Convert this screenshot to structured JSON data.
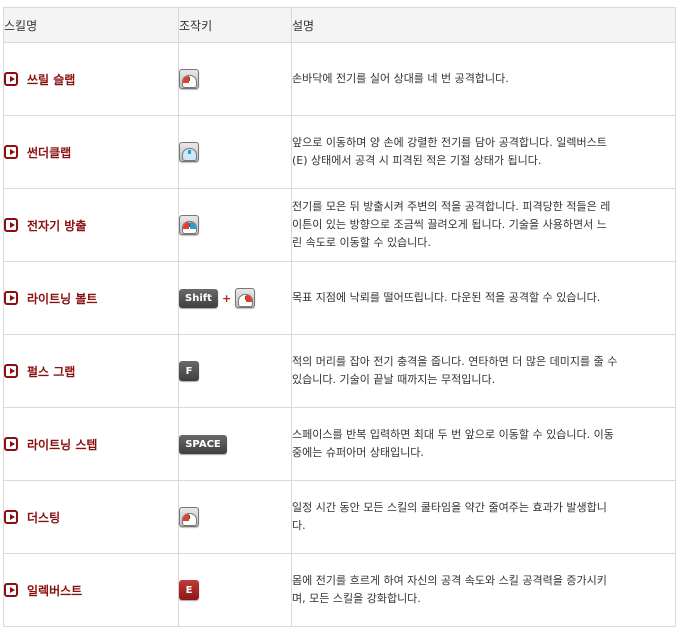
{
  "header": {
    "col_name": "스킬명",
    "col_key": "조작키",
    "col_desc": "설명"
  },
  "colors": {
    "skill_name": "#8a1010",
    "accent_red": "#e0402a",
    "accent_blue": "#2a9ad8"
  },
  "skills": [
    {
      "name": "쓰릴 슬랩",
      "key_icon": "mouse-left-click-icon",
      "desc": [
        "손바닥에 전기를 실어 상대를 네 번 공격합니다."
      ]
    },
    {
      "name": "썬더클랩",
      "key_icon": "mouse-wheel-icon",
      "desc": [
        "앞으로 이동하며 양 손에 강렬한 전기를 담아 공격합니다. 일렉버스트",
        "(E) 상태에서 공격 시 피격된 적은 기절 상태가 됩니다."
      ]
    },
    {
      "name": "전자기 방출",
      "key_icon": "mouse-both-click-icon",
      "desc": [
        "전기를 모은 뒤 방출시켜 주변의 적을 공격합니다. 피격당한 적들은 레",
        "이튼이 있는 방향으로 조금씩 끌려오게 됩니다. 기술을 사용하면서 느",
        "린 속도로 이동할 수 있습니다."
      ]
    },
    {
      "name": "라이트닝 볼트",
      "key_shift": "Shift",
      "plus": "+",
      "key_icon": "mouse-right-click-icon",
      "desc": [
        "목표 지점에 낙뢰를 떨어뜨립니다. 다운된 적을 공격할 수 있습니다."
      ]
    },
    {
      "name": "펄스 그랩",
      "key_text": "F",
      "desc": [
        "적의 머리를 잡아 전기 충격을 줍니다. 연타하면 더 많은 데미지를 줄 수",
        "있습니다. 기술이 끝날 때까지는 무적입니다."
      ]
    },
    {
      "name": "라이트닝 스텝",
      "key_text": "SPACE",
      "desc": [
        "스페이스를 반복 입력하면 최대 두 번 앞으로 이동할 수 있습니다. 이동",
        "중에는 슈퍼아머 상태입니다."
      ]
    },
    {
      "name": "더스팅",
      "key_icon": "mouse-left-hold-icon",
      "desc": [
        "일정 시간 동안 모든 스킬의 쿨타임을 약간 줄여주는 효과가 발생합니",
        "다."
      ]
    },
    {
      "name": "일렉버스트",
      "key_text": "E",
      "desc": [
        "몸에 전기를 흐르게 하여 자신의 공격 속도와 스킬 공격력을 증가시키",
        "며, 모든 스킬을 강화합니다."
      ]
    }
  ]
}
